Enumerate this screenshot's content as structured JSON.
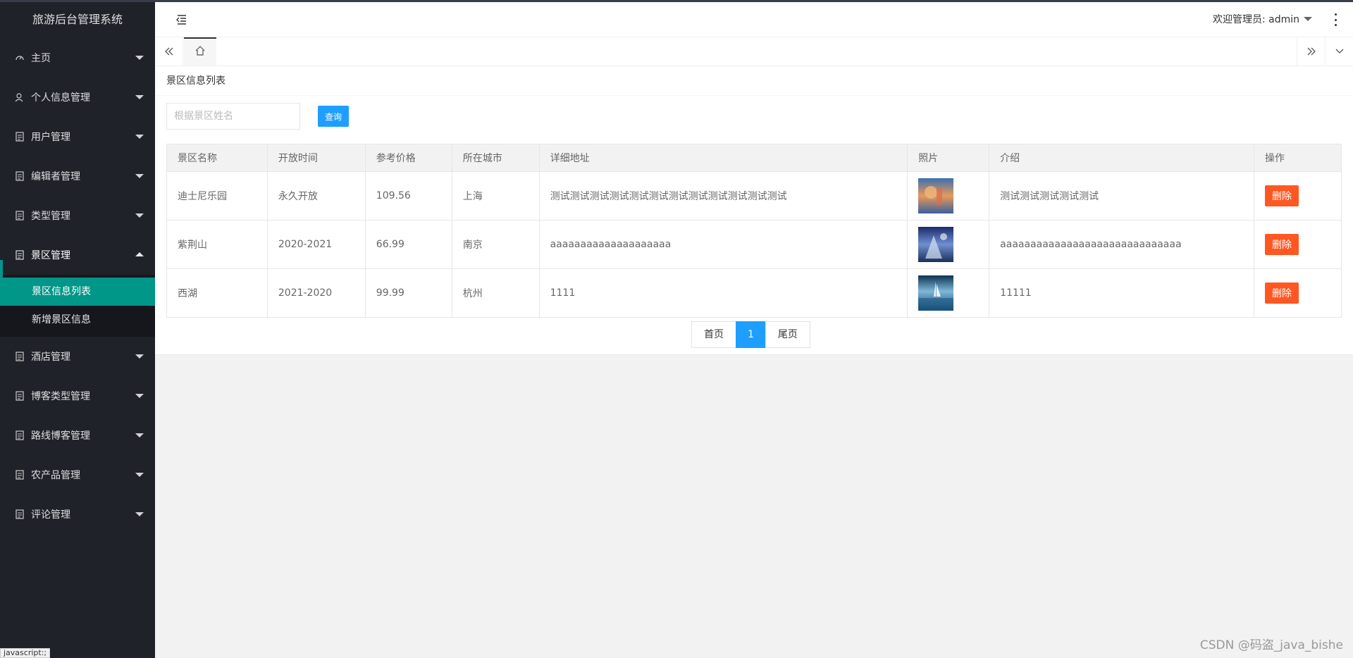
{
  "app": {
    "title": "旅游后台管理系统"
  },
  "sidebar": {
    "items": [
      {
        "label": "主页",
        "icon": "dashboard-icon"
      },
      {
        "label": "个人信息管理",
        "icon": "user-icon"
      },
      {
        "label": "用户管理",
        "icon": "doc-icon"
      },
      {
        "label": "编辑者管理",
        "icon": "doc-icon"
      },
      {
        "label": "类型管理",
        "icon": "doc-icon"
      },
      {
        "label": "景区管理",
        "icon": "doc-icon",
        "expanded": true,
        "children": [
          {
            "label": "景区信息列表",
            "active": true
          },
          {
            "label": "新增景区信息"
          }
        ]
      },
      {
        "label": "酒店管理",
        "icon": "doc-icon"
      },
      {
        "label": "博客类型管理",
        "icon": "doc-icon"
      },
      {
        "label": "路线博客管理",
        "icon": "doc-icon"
      },
      {
        "label": "农产品管理",
        "icon": "doc-icon"
      },
      {
        "label": "评论管理",
        "icon": "doc-icon"
      }
    ]
  },
  "header": {
    "welcome": "欢迎管理员: admin"
  },
  "page": {
    "title": "景区信息列表",
    "search": {
      "placeholder": "根据景区姓名",
      "value": "",
      "button": "查询"
    },
    "table": {
      "columns": [
        "景区名称",
        "开放时间",
        "参考价格",
        "所在城市",
        "详细地址",
        "照片",
        "介绍",
        "操作"
      ],
      "rows": [
        {
          "name": "迪士尼乐园",
          "open": "永久开放",
          "price": "109.56",
          "city": "上海",
          "address": "测试测试测试测试测试测试测试测试测试测试测试测试",
          "intro": "测试测试测试测试测试",
          "action": "删除"
        },
        {
          "name": "紫荆山",
          "open": "2020-2021",
          "price": "66.99",
          "city": "南京",
          "address": "aaaaaaaaaaaaaaaaaaaa",
          "intro": "aaaaaaaaaaaaaaaaaaaaaaaaaaaaaa",
          "action": "删除"
        },
        {
          "name": "西湖",
          "open": "2021-2020",
          "price": "99.99",
          "city": "杭州",
          "address": "1111",
          "intro": "11111",
          "action": "删除"
        }
      ]
    },
    "pager": {
      "first": "首页",
      "current": "1",
      "last": "尾页"
    }
  },
  "statusbar": {
    "text": "javascript:;"
  },
  "watermark": "CSDN @码盗_java_bishe",
  "colors": {
    "sidebar": "#20222A",
    "accent": "#009688",
    "primary": "#1E9FFF",
    "danger": "#FF5722"
  }
}
